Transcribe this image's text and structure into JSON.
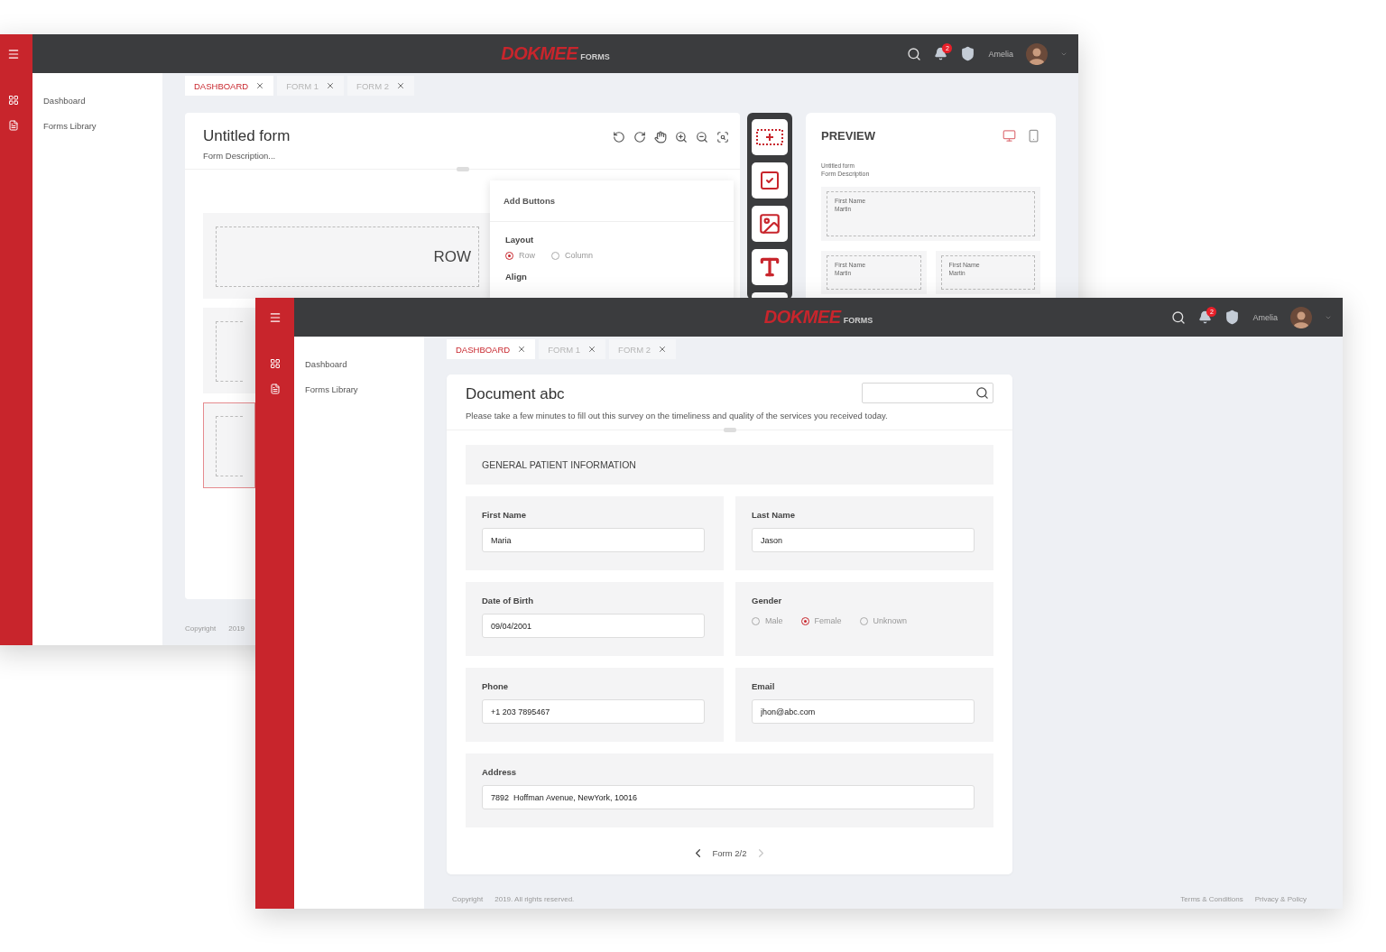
{
  "editor_window": {
    "header": {
      "logo": "DOKMEE",
      "product": "FORMS",
      "notifications": "2",
      "user": "Amelia"
    },
    "sidebar": {
      "items": [
        {
          "label": "Dashboard"
        },
        {
          "label": "Forms Library"
        }
      ]
    },
    "tabs": [
      {
        "label": "DASHBOARD",
        "selected": true
      },
      {
        "label": "FORM 1",
        "selected": false
      },
      {
        "label": "FORM 2",
        "selected": false
      }
    ],
    "form": {
      "title": "Untitled form",
      "description": "Form Description..."
    },
    "canvas_rows": [
      {
        "label": "ROW",
        "selected": false
      },
      {
        "selected": false
      },
      {
        "selected": true
      }
    ],
    "popup": {
      "title": "Add Buttons",
      "groups": [
        {
          "label": "Layout",
          "options": [
            {
              "label": "Row",
              "selected": true
            },
            {
              "label": "Column",
              "selected": false
            }
          ]
        },
        {
          "label": "Align"
        }
      ]
    },
    "preview": {
      "title": "PREVIEW",
      "devices": [
        {
          "selected": true
        },
        {
          "selected": false
        }
      ],
      "form_title": "Untitled form",
      "form_description": "Form Description",
      "rows": [
        [
          {
            "label": "First Name",
            "value": "Martin"
          }
        ],
        [
          {
            "label": "First Name",
            "value": "Martin"
          },
          {
            "label": "First Name",
            "value": "Martin"
          }
        ]
      ]
    },
    "footer": {
      "copyright": "Copyright",
      "year": "2019"
    }
  },
  "form_window": {
    "header": {
      "logo": "DOKMEE",
      "product": "FORMS",
      "notifications": "2",
      "user": "Amelia"
    },
    "sidebar": {
      "items": [
        {
          "label": "Dashboard"
        },
        {
          "label": "Forms Library"
        }
      ]
    },
    "tabs": [
      {
        "label": "DASHBOARD",
        "selected": true
      },
      {
        "label": "FORM 1",
        "selected": false
      },
      {
        "label": "FORM 2",
        "selected": false
      }
    ],
    "form": {
      "title": "Document abc",
      "description": "Please take a few minutes to fill out this survey on the timeliness and quality of the services you received today.",
      "section": "GENERAL PATIENT INFORMATION",
      "rows": [
        [
          {
            "kind": "text",
            "label": "First Name",
            "value": "Maria"
          },
          {
            "kind": "text",
            "label": "Last Name",
            "value": "Jason"
          }
        ],
        [
          {
            "kind": "text",
            "label": "Date of Birth",
            "value": "09/04/2001"
          },
          {
            "kind": "radio",
            "label": "Gender",
            "options": [
              {
                "label": "Male",
                "selected": false
              },
              {
                "label": "Female",
                "selected": true
              },
              {
                "label": "Unknown",
                "selected": false
              }
            ]
          }
        ],
        [
          {
            "kind": "text",
            "label": "Phone",
            "value": "+1 203 7895467"
          },
          {
            "kind": "text",
            "label": "Email",
            "value": "jhon@abc.com"
          }
        ],
        [
          {
            "kind": "text",
            "label": "Address",
            "value": "7892  Hoffman Avenue, NewYork, 10016"
          }
        ]
      ],
      "pager": {
        "label": "Form 2/2",
        "prev_disabled": false,
        "next_disabled": true
      }
    },
    "footer": {
      "copyright": "Copyright",
      "notice": "2019. All rights reserved.",
      "links": [
        "Terms & Conditions",
        "Privacy & Policy"
      ]
    }
  }
}
